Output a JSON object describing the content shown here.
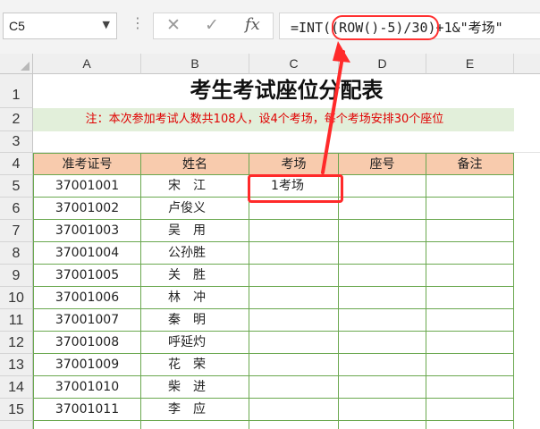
{
  "formula_bar": {
    "name_box": "C5",
    "formula": "=INT((ROW()-5)/30)+1&\"考场\"",
    "cancel_icon": "✕",
    "enter_icon": "✓",
    "fx_label": "fx"
  },
  "columns": [
    "A",
    "B",
    "C",
    "D",
    "E"
  ],
  "rows": [
    "1",
    "2",
    "3",
    "4",
    "5",
    "6",
    "7",
    "8",
    "9",
    "10",
    "11",
    "12",
    "13",
    "14",
    "15"
  ],
  "sheet": {
    "title": "考生考试座位分配表",
    "note": "注：本次参加考试人数共108人，设4个考场，每个考场安排30个座位",
    "headers": [
      "准考证号",
      "姓名",
      "考场",
      "座号",
      "备注"
    ],
    "records": [
      {
        "id": "37001001",
        "name": "宋　江",
        "room": "1考场"
      },
      {
        "id": "37001002",
        "name": "卢俊义",
        "room": ""
      },
      {
        "id": "37001003",
        "name": "吴　用",
        "room": ""
      },
      {
        "id": "37001004",
        "name": "公孙胜",
        "room": ""
      },
      {
        "id": "37001005",
        "name": "关　胜",
        "room": ""
      },
      {
        "id": "37001006",
        "name": "林　冲",
        "room": ""
      },
      {
        "id": "37001007",
        "name": "秦　明",
        "room": ""
      },
      {
        "id": "37001008",
        "name": "呼延灼",
        "room": ""
      },
      {
        "id": "37001009",
        "name": "花　荣",
        "room": ""
      },
      {
        "id": "37001010",
        "name": "柴　进",
        "room": ""
      },
      {
        "id": "37001011",
        "name": "李　应",
        "room": ""
      }
    ]
  },
  "colors": {
    "header_fill": "#f8cbad",
    "note_fill": "#e2efda",
    "grid": "#6aa84f",
    "annotation": "#ff2a2a"
  }
}
